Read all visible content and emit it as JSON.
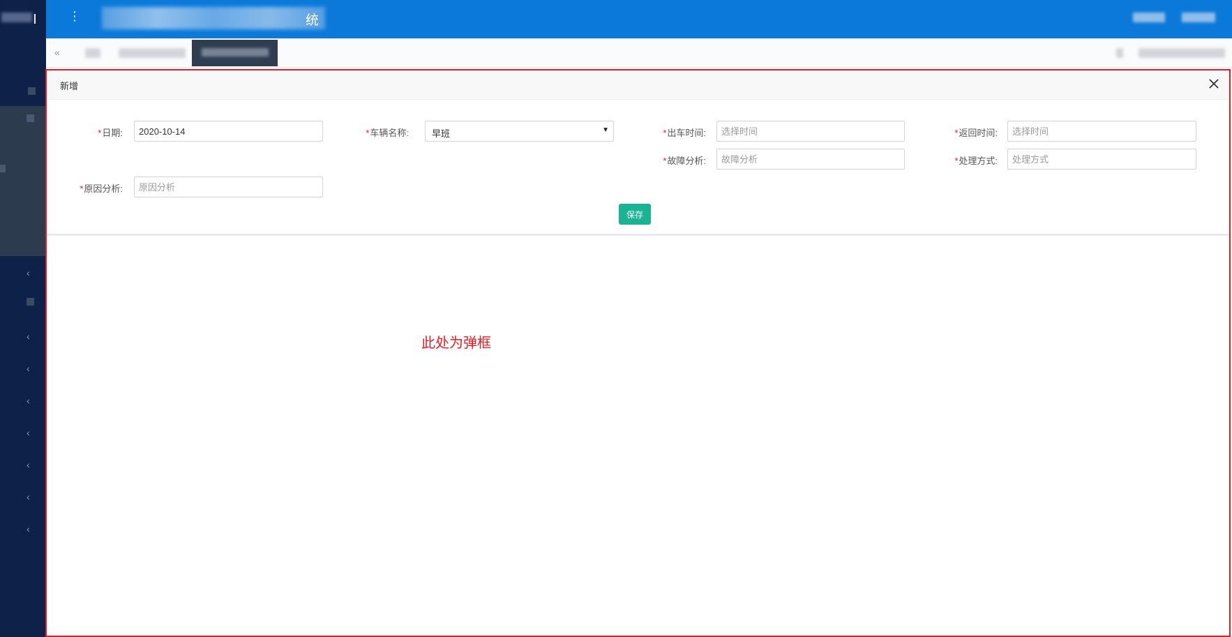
{
  "colors": {
    "header": "#0a79d9",
    "sidebar": "#0e2149",
    "accent_button": "#1ab394",
    "required_mark": "#e51c23",
    "annotation_border": "#e51c23"
  },
  "header": {
    "title_tail": "统",
    "menu_icon": "ellipsis-vertical-icon"
  },
  "tabs": {
    "back_icon": "double-chevron-left-icon"
  },
  "dialog": {
    "title": "新增",
    "close_icon": "close-icon",
    "form": {
      "required_mark": "*",
      "date": {
        "label": "日期:",
        "value": "2020-10-14"
      },
      "vehicle": {
        "label": "车辆名称:",
        "value": "早班"
      },
      "depart_time": {
        "label": "出车时间:",
        "placeholder": "选择时间"
      },
      "return_time": {
        "label": "返回时间:",
        "placeholder": "选择时间"
      },
      "fault_analysis": {
        "label": "故障分析:",
        "placeholder": "故障分析"
      },
      "handling": {
        "label": "处理方式:",
        "placeholder": "处理方式"
      },
      "cause_analysis": {
        "label": "原因分析:",
        "placeholder": "原因分析"
      }
    },
    "save_label": "保存"
  },
  "annotation": {
    "text": "此处为弹框"
  }
}
